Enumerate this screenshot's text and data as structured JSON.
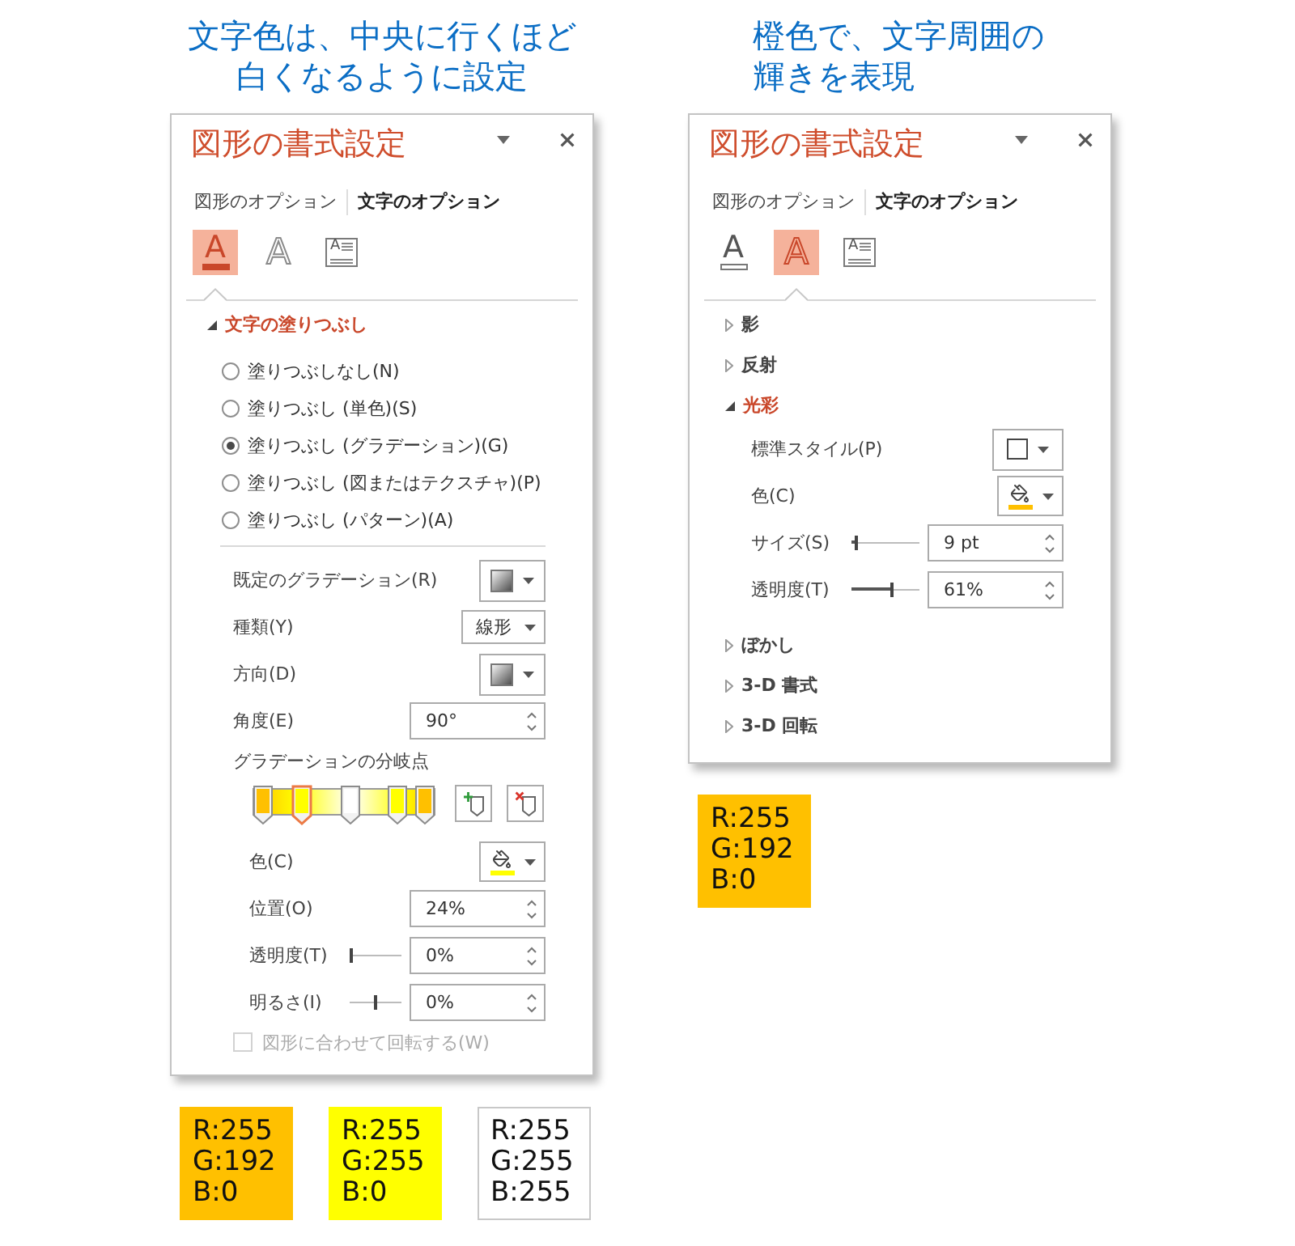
{
  "columns": [
    {
      "caption": [
        "文字色は、中央に行くほど",
        "白くなるように設定"
      ],
      "panel": {
        "title": "図形の書式設定",
        "tabs": [
          {
            "label": "図形のオプション",
            "selected": false
          },
          {
            "label": "文字のオプション",
            "selected": true
          }
        ],
        "icon_tabs": [
          {
            "kind": "fill",
            "glyph": "A",
            "selected": true
          },
          {
            "kind": "effects",
            "glyph": "A",
            "selected": false
          },
          {
            "kind": "layout",
            "glyph": "A",
            "selected": false
          }
        ],
        "sections": [
          {
            "title": "文字の塗りつぶし",
            "expanded": true,
            "options": [
              {
                "label": "塗りつぶしなし(N)",
                "selected": false
              },
              {
                "label": "塗りつぶし (単色)(S)",
                "selected": false
              },
              {
                "label": "塗りつぶし (グラデーション)(G)",
                "selected": true
              },
              {
                "label": "塗りつぶし (図またはテクスチャ)(P)",
                "selected": false
              },
              {
                "label": "塗りつぶし (パターン)(A)",
                "selected": false
              }
            ],
            "rows": [
              {
                "kind": "gradient_picker",
                "label": "既定のグラデーション(R)"
              },
              {
                "kind": "select",
                "label": "種類(Y)",
                "value": "線形"
              },
              {
                "kind": "gradient_picker",
                "label": "方向(D)"
              },
              {
                "kind": "spinner",
                "label": "角度(E)",
                "value": "90°"
              },
              {
                "kind": "stops",
                "label": "グラデーションの分岐点",
                "stops": [
                  {
                    "level": 0,
                    "color": "#ffc000",
                    "selected": false
                  },
                  {
                    "level": 0.24,
                    "color": "#ffff00",
                    "selected": true
                  },
                  {
                    "level": 0.54,
                    "color": "#ffffff",
                    "selected": false
                  },
                  {
                    "level": 0.83,
                    "color": "#ffff00",
                    "selected": false
                  },
                  {
                    "level": 1,
                    "color": "#ffc000",
                    "selected": false
                  }
                ],
                "children": [
                  {
                    "kind": "color",
                    "label": "色(C)",
                    "color": "#ffff00"
                  },
                  {
                    "kind": "spinner",
                    "label": "位置(O)",
                    "value": "24%"
                  },
                  {
                    "kind": "slider",
                    "label": "透明度(T)",
                    "level": 0,
                    "value": "0%"
                  },
                  {
                    "kind": "balance_slider",
                    "label": "明るさ(I)",
                    "level": 0.5,
                    "value": "0%"
                  }
                ]
              },
              {
                "kind": "checkbox",
                "label": "図形に合わせて回転する(W)",
                "checked": false,
                "disabled": true
              }
            ]
          }
        ]
      },
      "swatches": [
        {
          "color": "#ffc000",
          "label": "R:255\nG:192\nB:0"
        },
        {
          "color": "#ffff00",
          "label": "R:255\nG:255\nB:0"
        },
        {
          "color": "#ffffff",
          "label": "R:255\nG:255\nB:255"
        }
      ]
    },
    {
      "caption": [
        "橙色で、文字周囲の",
        "輝きを表現"
      ],
      "panel": {
        "title": "図形の書式設定",
        "tabs": [
          {
            "label": "図形のオプション",
            "selected": false
          },
          {
            "label": "文字のオプション",
            "selected": true
          }
        ],
        "icon_tabs": [
          {
            "kind": "fill",
            "glyph": "A",
            "selected": false
          },
          {
            "kind": "effects",
            "glyph": "A",
            "selected": true
          },
          {
            "kind": "layout",
            "glyph": "A",
            "selected": false
          }
        ],
        "sections": [
          {
            "title": "影",
            "expanded": false
          },
          {
            "title": "反射",
            "expanded": false
          },
          {
            "title": "光彩",
            "expanded": true,
            "rows": [
              {
                "kind": "style_picker",
                "label": "標準スタイル(P)"
              },
              {
                "kind": "color",
                "label": "色(C)",
                "color": "#ffc000"
              },
              {
                "kind": "slider",
                "label": "サイズ(S)",
                "level": 0.06,
                "value": "9 pt"
              },
              {
                "kind": "slider",
                "label": "透明度(T)",
                "level": 0.61,
                "value": "61%"
              }
            ]
          },
          {
            "title": "ぼかし",
            "expanded": false
          },
          {
            "title": "3-D 書式",
            "expanded": false
          },
          {
            "title": "3-D 回転",
            "expanded": false
          }
        ]
      },
      "swatches": [
        {
          "color": "#ffc000",
          "label": "R:255\nG:192\nB:0"
        }
      ]
    }
  ]
}
